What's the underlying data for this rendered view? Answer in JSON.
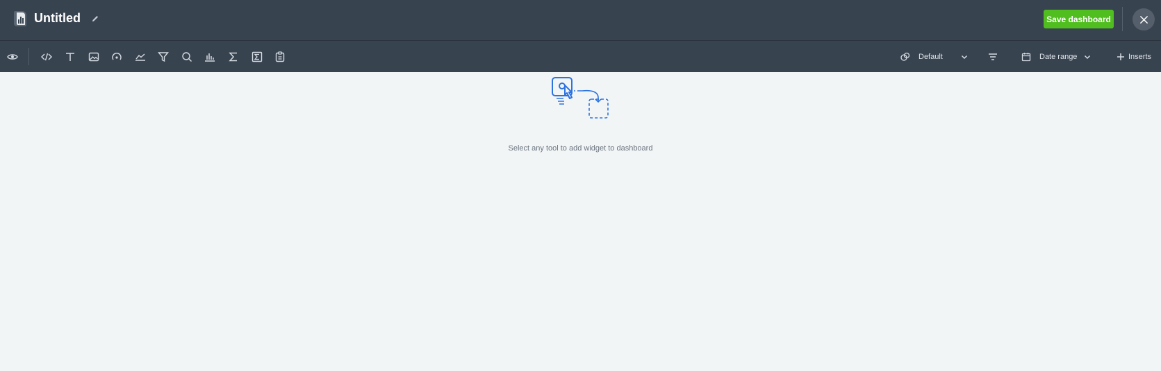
{
  "header": {
    "title": "Untitled",
    "save_label": "Save dashboard"
  },
  "toolbar": {
    "tools": [
      "eye-icon",
      "code-icon",
      "text-icon",
      "image-icon",
      "gauge-icon",
      "line-chart-icon",
      "funnel-icon",
      "search-chart-icon",
      "bar-chart-icon",
      "sigma-icon",
      "formula-icon",
      "clipboard-icon"
    ],
    "theme_label": "Default",
    "date_range_label": "Date range",
    "inserts_label": "Inserts"
  },
  "canvas": {
    "empty_message": "Select any tool to add widget to dashboard"
  },
  "colors": {
    "header_bg": "#384350",
    "accent_green": "#4fbe1e",
    "illustration_blue": "#2d73e0",
    "canvas_bg": "#f2f5f6"
  }
}
